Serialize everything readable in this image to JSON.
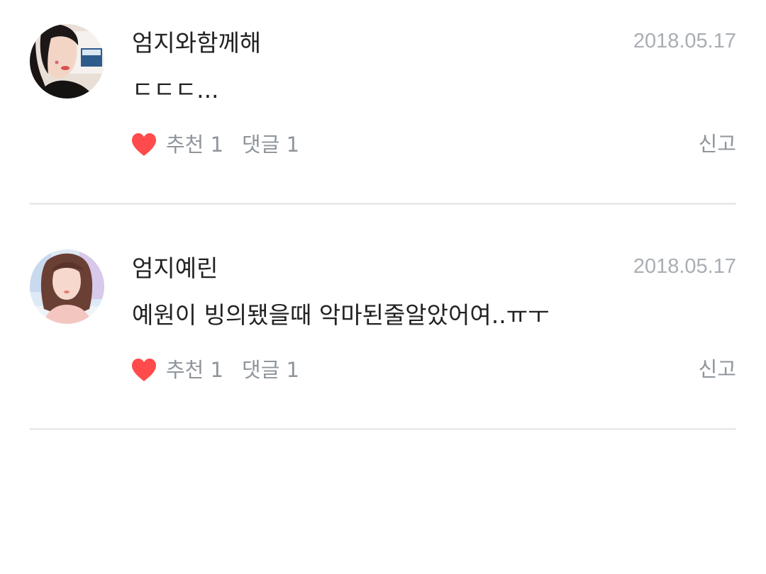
{
  "comments": [
    {
      "author": "엄지와함께해",
      "date": "2018.05.17",
      "text": "ㄷㄷㄷ...",
      "likes_label": "추천 1",
      "replies_label": "댓글 1",
      "report_label": "신고",
      "avatar": "profile-photo"
    },
    {
      "author": "엄지예린",
      "date": "2018.05.17",
      "text": "예원이 빙의됐을때 악마된줄알았어여..ㅠㅜ",
      "likes_label": "추천 1",
      "replies_label": "댓글 1",
      "report_label": "신고",
      "avatar": "profile-photo"
    }
  ],
  "icons": {
    "like": "heart-icon"
  },
  "colors": {
    "heart": "#ff4b4b",
    "meta_text": "#8f959b",
    "date_text": "#a9aeb4",
    "divider": "#e9ebed"
  }
}
